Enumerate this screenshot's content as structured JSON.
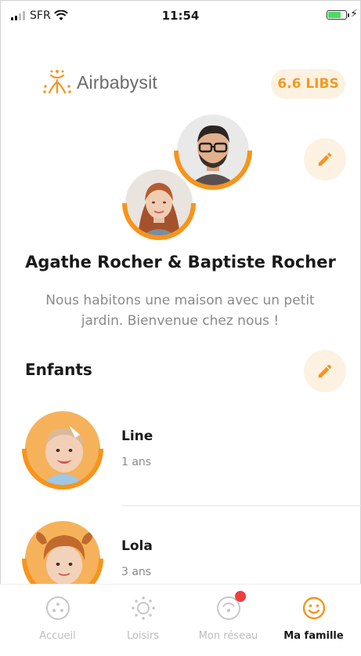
{
  "status_bar": {
    "carrier": "SFR",
    "time": "11:54"
  },
  "header": {
    "brand": "Airbabysit",
    "libs_balance": "6.6 LIBS"
  },
  "family": {
    "names": "Agathe Rocher  & Baptiste Rocher",
    "description": "Nous habitons une maison avec un petit jardin. Bienvenue chez nous !"
  },
  "children_section": {
    "title": "Enfants",
    "children": [
      {
        "name": "Line",
        "age": "1 ans"
      },
      {
        "name": "Lola",
        "age": "3 ans"
      }
    ]
  },
  "tabbar": {
    "tabs": [
      {
        "label": "Accueil",
        "icon": "home-dots-icon",
        "active": false
      },
      {
        "label": "Loisirs",
        "icon": "sun-icon",
        "active": false
      },
      {
        "label": "Mon réseau",
        "icon": "radar-icon",
        "active": false,
        "badge": true
      },
      {
        "label": "Ma famille",
        "icon": "smiley-icon",
        "active": true
      }
    ]
  },
  "colors": {
    "accent": "#f7941d",
    "accent_light": "#fdf1e2",
    "badge": "#ef3e42"
  }
}
